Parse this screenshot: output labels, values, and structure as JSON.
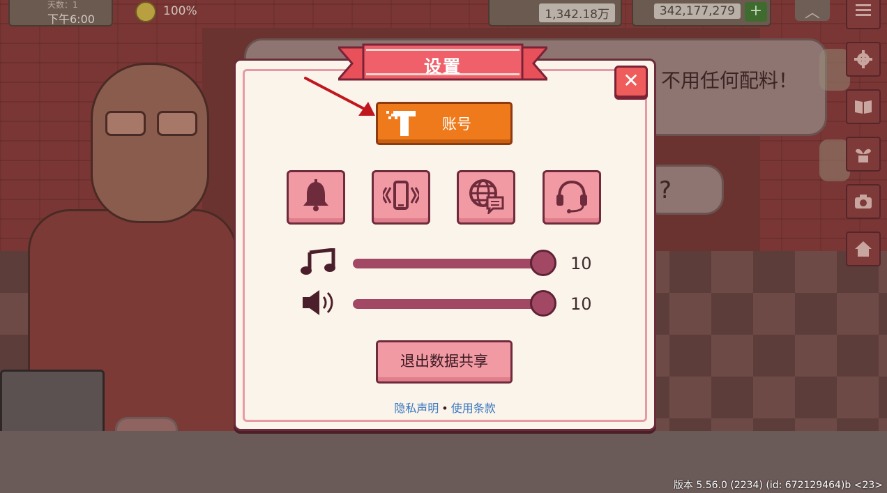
{
  "hud": {
    "day_label": "天数：1",
    "time": "下午6:00",
    "mood": "100%",
    "cash": "1,342.18万",
    "gems": "342,177,279",
    "gems_plus": "+"
  },
  "background": {
    "bubble_text": "不用任何配料！",
    "bubble_text_2": "?"
  },
  "dialog": {
    "title": "设置",
    "close": "✕",
    "account_label": "账号",
    "icon_buttons": [
      "bell-icon",
      "vibrate-icon",
      "language-icon",
      "support-headset-icon"
    ],
    "music": {
      "value": "10",
      "level": 1.0
    },
    "sound": {
      "value": "10",
      "level": 1.0
    },
    "exit_label": "退出数据共享",
    "privacy_link": "隐私声明",
    "separator": "•",
    "terms_link": "使用条款"
  },
  "side_menu": [
    "menu-icon",
    "settings-icon",
    "book-icon",
    "plant-icon",
    "camera-icon",
    "home-icon"
  ],
  "version": "版本 5.56.0 (2234) (id: 672129464)b <23>",
  "colors": {
    "dialog_bg": "#fbf4ea",
    "accent_pink": "#f29aa4",
    "account_orange": "#ee7a1c",
    "slider": "#a24864",
    "close_red": "#ee5c5c",
    "link_blue": "#3a78c0",
    "arrow_red": "#c0161e"
  }
}
